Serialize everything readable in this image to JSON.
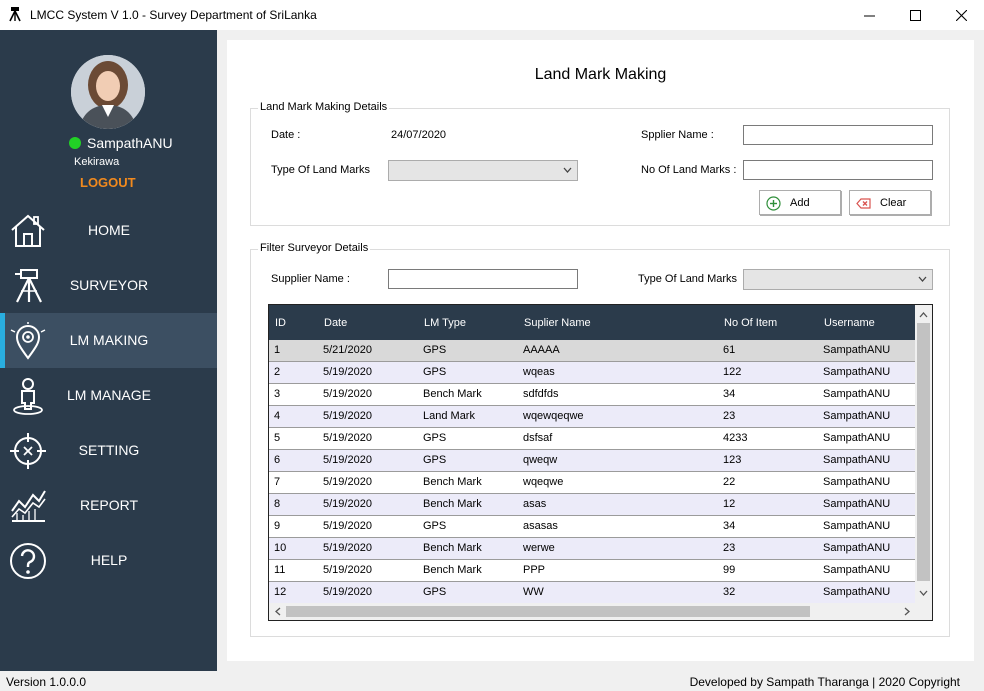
{
  "window": {
    "title": "LMCC System V 1.0 - Survey Department of SriLanka",
    "app_icon": "surveyor-tripod-icon"
  },
  "sidebar": {
    "user": {
      "name": "SampathANU",
      "location": "Kekirawa",
      "status_color": "#22d126",
      "logout_label": "LOGOUT"
    },
    "items": [
      {
        "label": "HOME",
        "icon": "home-icon",
        "active": false
      },
      {
        "label": "SURVEYOR",
        "icon": "surveyor-tripod-icon",
        "active": false
      },
      {
        "label": "LM MAKING",
        "icon": "location-pin-icon",
        "active": true
      },
      {
        "label": "LM MANAGE",
        "icon": "person-pin-icon",
        "active": false
      },
      {
        "label": "SETTING",
        "icon": "crosshair-icon",
        "active": false
      },
      {
        "label": "REPORT",
        "icon": "chart-icon",
        "active": false
      },
      {
        "label": "HELP",
        "icon": "help-icon",
        "active": false
      }
    ],
    "background": "#2b3b4b",
    "active_background": "#3c4f62",
    "accent": "#29aee0",
    "logout_color": "#f28a1e"
  },
  "main": {
    "title": "Land Mark Making",
    "details": {
      "legend": "Land Mark Making Details",
      "date_label": "Date :",
      "date_value": "24/07/2020",
      "type_label": "Type Of Land Marks",
      "type_value": "",
      "supplier_label": "Spplier Name :",
      "supplier_value": "",
      "count_label": "No Of Land Marks :",
      "count_value": "",
      "add_label": "Add",
      "clear_label": "Clear"
    },
    "filter": {
      "legend": "Filter Surveyor Details",
      "supplier_label": "Supplier Name :",
      "supplier_value": "",
      "type_label": "Type Of Land Marks",
      "type_value": ""
    },
    "table": {
      "columns": [
        "ID",
        "Date",
        "LM Type",
        "Suplier Name",
        "No Of Item",
        "Username"
      ],
      "rows": [
        [
          "1",
          "5/21/2020",
          "GPS",
          "AAAAA",
          "61",
          "SampathANU"
        ],
        [
          "2",
          "5/19/2020",
          "GPS",
          "wqeas",
          "122",
          "SampathANU"
        ],
        [
          "3",
          "5/19/2020",
          "Bench Mark",
          "sdfdfds",
          "34",
          "SampathANU"
        ],
        [
          "4",
          "5/19/2020",
          "Land Mark",
          "wqewqeqwe",
          "23",
          "SampathANU"
        ],
        [
          "5",
          "5/19/2020",
          "GPS",
          "dsfsaf",
          "4233",
          "SampathANU"
        ],
        [
          "6",
          "5/19/2020",
          "GPS",
          "qweqw",
          "123",
          "SampathANU"
        ],
        [
          "7",
          "5/19/2020",
          "Bench Mark",
          "wqeqwe",
          "22",
          "SampathANU"
        ],
        [
          "8",
          "5/19/2020",
          "Bench Mark",
          "asas",
          "12",
          "SampathANU"
        ],
        [
          "9",
          "5/19/2020",
          "GPS",
          "asasas",
          "34",
          "SampathANU"
        ],
        [
          "10",
          "5/19/2020",
          "Bench Mark",
          "werwe",
          "23",
          "SampathANU"
        ],
        [
          "11",
          "5/19/2020",
          "Bench Mark",
          "PPP",
          "99",
          "SampathANU"
        ],
        [
          "12",
          "5/19/2020",
          "GPS",
          "WW",
          "32",
          "SampathANU"
        ]
      ],
      "selected_row": 1,
      "header_background": "#2b3b4b"
    }
  },
  "footer": {
    "version": "Version 1.0.0.0",
    "copyright": "Developed by Sampath Tharanga | 2020 Copyright"
  }
}
